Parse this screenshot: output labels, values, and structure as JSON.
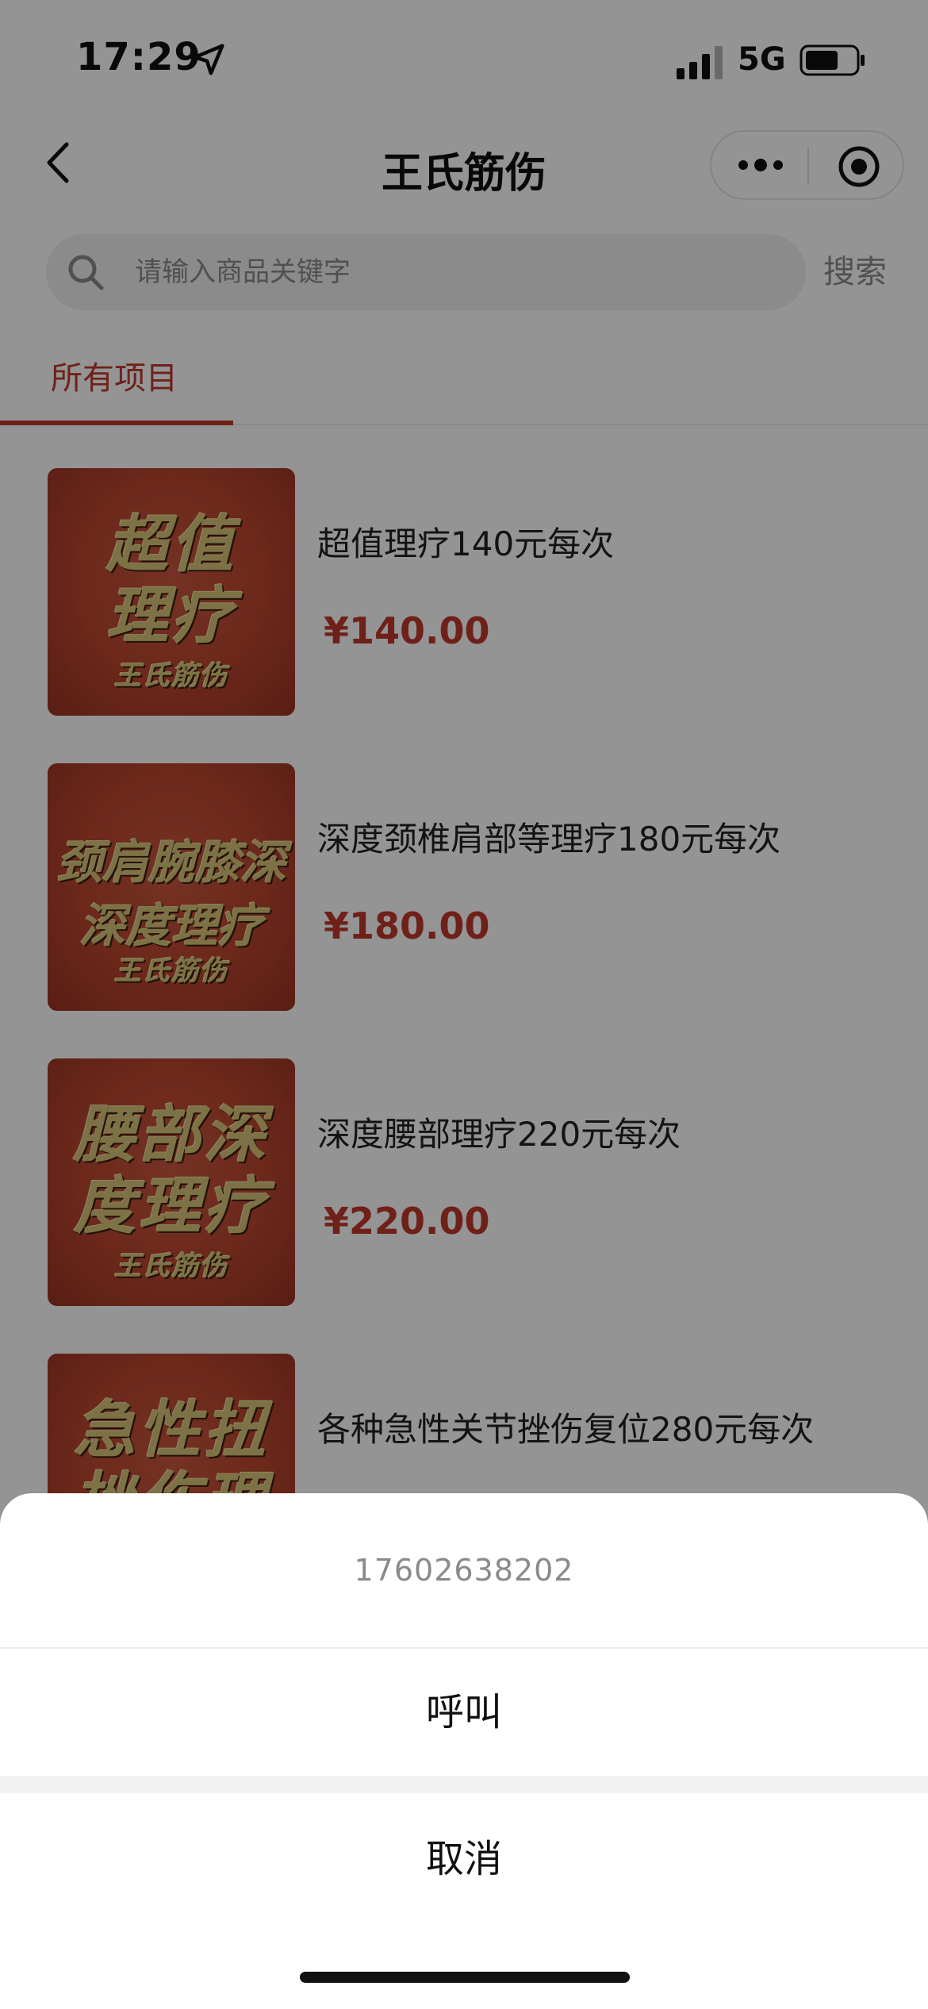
{
  "status_bar": {
    "time": "17:29",
    "network": "5G",
    "icons": [
      "location-arrow-icon",
      "signal-icon",
      "battery-icon"
    ]
  },
  "nav": {
    "title": "王氏筋伤",
    "icons": [
      "back-chevron-icon",
      "more-dots-icon",
      "target-circle-icon"
    ]
  },
  "search": {
    "placeholder": "请输入商品关键字",
    "button": "搜索",
    "icon": "search-icon"
  },
  "tabs": [
    {
      "label": "所有项目",
      "active": true
    }
  ],
  "products": [
    {
      "name": "超值理疗140元每次",
      "price": "¥140.00",
      "thumb_line1": "超值",
      "thumb_line2": "理疗",
      "thumb_brand": "王氏筋伤"
    },
    {
      "name": "深度颈椎肩部等理疗180元每次",
      "price": "¥180.00",
      "thumb_line1": "颈肩腕膝深",
      "thumb_line2": "深度理疗",
      "thumb_brand": "王氏筋伤"
    },
    {
      "name": "深度腰部理疗220元每次",
      "price": "¥220.00",
      "thumb_line1": "腰部深",
      "thumb_line2": "度理疗",
      "thumb_brand": "王氏筋伤"
    },
    {
      "name": "各种急性关节挫伤复位280元每次",
      "thumb_line1": "急性扭伤",
      "thumb_line2": "挫伤理疗"
    }
  ],
  "action_sheet": {
    "phone": "17602638202",
    "call": "呼叫",
    "cancel": "取消"
  },
  "colors": {
    "accent": "#c0392b",
    "overlay": "rgba(0,0,0,0.42)",
    "thumb_bg": "#b8452f",
    "thumb_text": "#d8c478"
  }
}
